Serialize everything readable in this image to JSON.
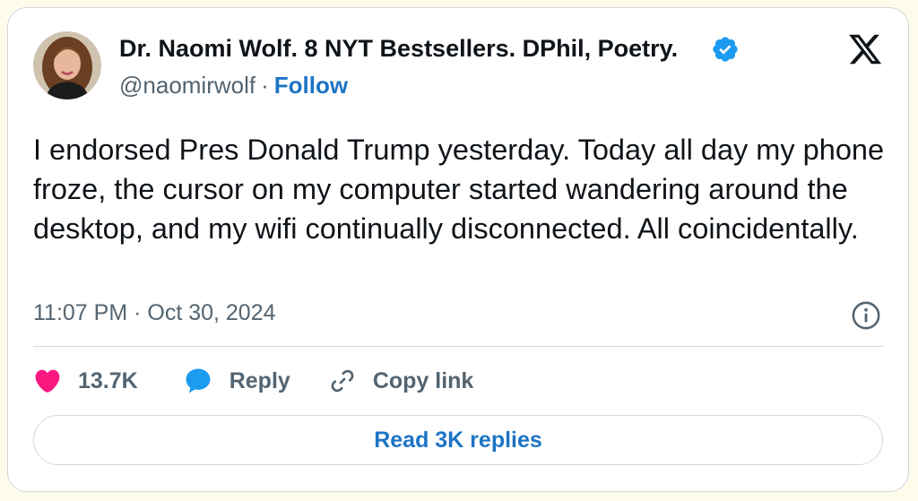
{
  "author": {
    "display_name": "Dr. Naomi Wolf. 8 NYT Bestsellers. DPhil, Poetry.",
    "handle": "@naomirwolf",
    "separator": "·",
    "follow_label": "Follow",
    "avatar_icon": "profile-photo",
    "verified_icon": "verified-badge-icon"
  },
  "tweet": {
    "text": "I endorsed Pres Donald Trump yesterday. Today all day my phone froze, the cursor on my computer started wandering around the desktop, and my wifi continually disconnected. All coincidentally.",
    "timestamp": "11:07 PM · Oct 30, 2024"
  },
  "actions": {
    "like_count": "13.7K",
    "reply_label": "Reply",
    "copy_link_label": "Copy link"
  },
  "footer": {
    "read_replies_label": "Read 3K replies"
  },
  "icons": {
    "brand": "x-logo-icon",
    "info": "info-icon",
    "like": "heart-icon",
    "reply": "speech-bubble-icon",
    "copy": "link-icon"
  },
  "colors": {
    "accent_blue": "#1d74c4",
    "verified_blue": "#1d9bf0",
    "heart_pink": "#f91880",
    "text_primary": "#0f1419",
    "text_secondary": "#536471",
    "page_background": "#fdfbe9"
  }
}
